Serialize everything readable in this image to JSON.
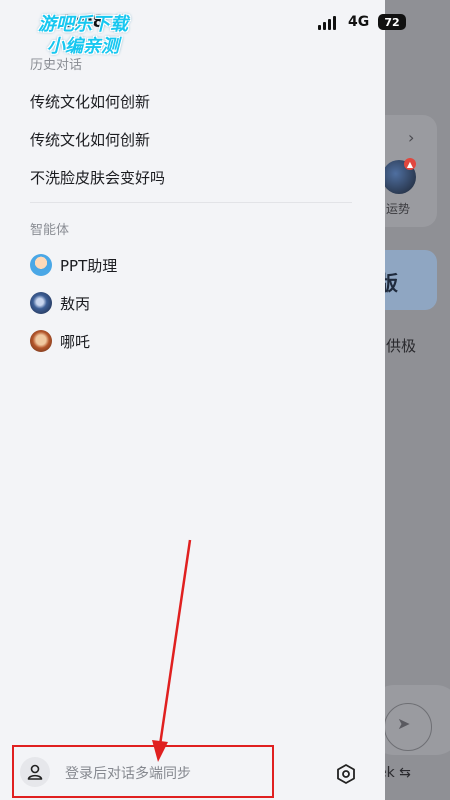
{
  "status_bar": {
    "time": "9:08",
    "network": "4G",
    "battery": "72"
  },
  "watermark": {
    "line1": "游吧乐下载",
    "line2": "小编亲测"
  },
  "drawer": {
    "history_title": "历史对话",
    "history": [
      {
        "label": "传统文化如何创新"
      },
      {
        "label": "传统文化如何创新"
      },
      {
        "label": "不洗脸皮肤会变好吗"
      }
    ],
    "agents_title": "智能体",
    "agents": [
      {
        "name": "PPT助理",
        "avatar": "ppt-assistant-avatar"
      },
      {
        "name": "敖丙",
        "avatar": "aobing-avatar"
      },
      {
        "name": "哪吒",
        "avatar": "nezha-avatar"
      }
    ],
    "login_prompt": "登录后对话多端同步"
  },
  "background_app": {
    "card_label": "运势",
    "banner_text": "版",
    "text": "供极",
    "bottom_text": "ek ⇆"
  },
  "colors": {
    "annotation": "#e02020",
    "watermark": "#17c7f0",
    "drawer_bg": "#f3f4f7"
  }
}
